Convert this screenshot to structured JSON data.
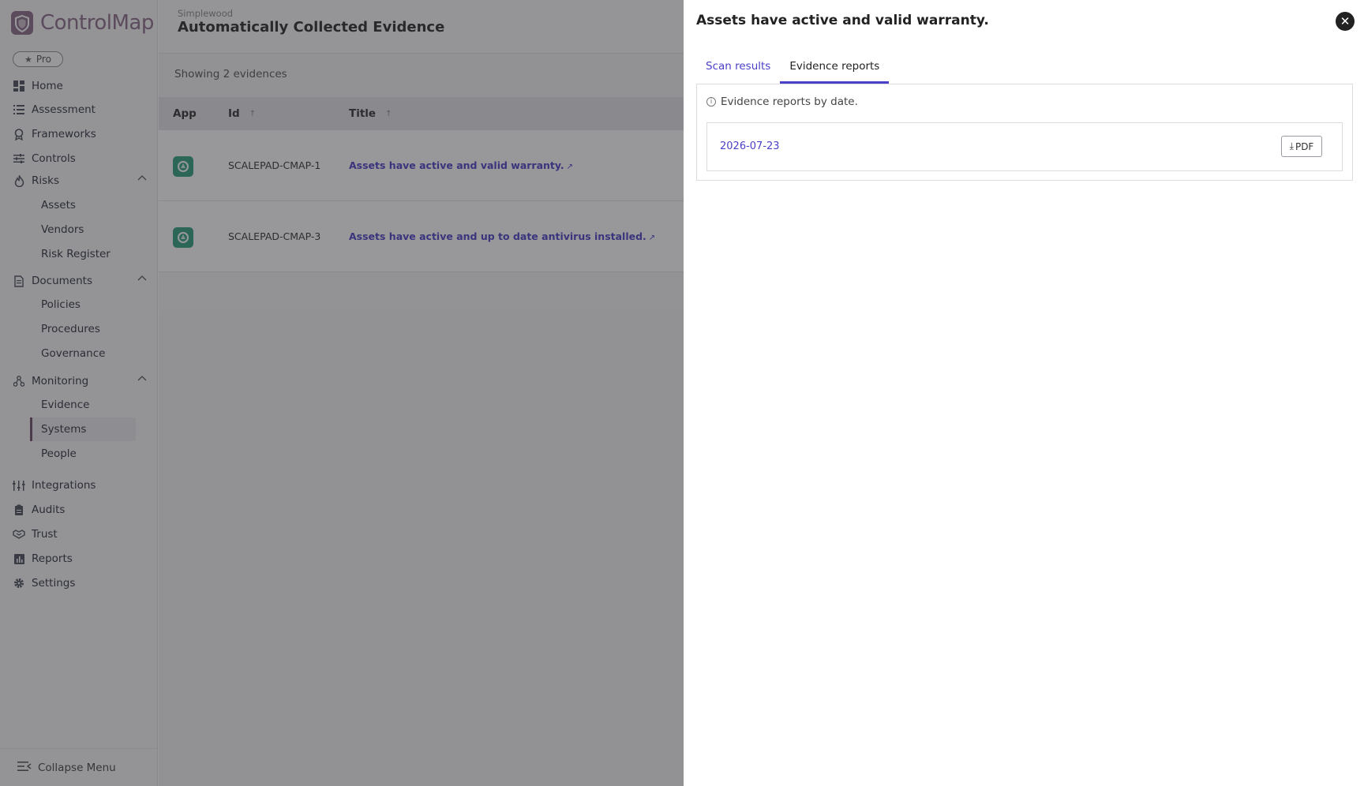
{
  "brand": {
    "name": "ControlMap",
    "plan": "Pro",
    "accent": "#8b6b8a"
  },
  "nav": {
    "home": "Home",
    "assessment": "Assessment",
    "frameworks": "Frameworks",
    "controls": "Controls",
    "risks": "Risks",
    "risks_items": [
      "Assets",
      "Vendors",
      "Risk Register"
    ],
    "documents": "Documents",
    "documents_items": [
      "Policies",
      "Procedures",
      "Governance"
    ],
    "monitoring": "Monitoring",
    "monitoring_items": [
      "Evidence",
      "Systems",
      "People"
    ],
    "integrations": "Integrations",
    "audits": "Audits",
    "trust": "Trust",
    "reports": "Reports",
    "settings": "Settings",
    "collapse": "Collapse Menu"
  },
  "header": {
    "org": "Simplewood",
    "title": "Automatically Collected Evidence"
  },
  "list": {
    "count": "Showing 2 evidences",
    "columns": {
      "app": "App",
      "id": "Id",
      "title": "Title"
    },
    "rows": [
      {
        "id": "SCALEPAD-CMAP-1",
        "title": "Assets have active and valid warranty."
      },
      {
        "id": "SCALEPAD-CMAP-3",
        "title": "Assets have active and up to date antivirus installed."
      }
    ]
  },
  "drawer": {
    "title": "Assets have active and valid warranty.",
    "tabs": {
      "scan": "Scan results",
      "reports": "Evidence reports"
    },
    "info": "Evidence reports by date.",
    "reports": [
      {
        "date": "2026-07-23",
        "action": "PDF"
      }
    ]
  },
  "colors": {
    "link": "#4b40c8",
    "app_icon": "#2f9f7f",
    "active_border": "#6e4d6c"
  }
}
